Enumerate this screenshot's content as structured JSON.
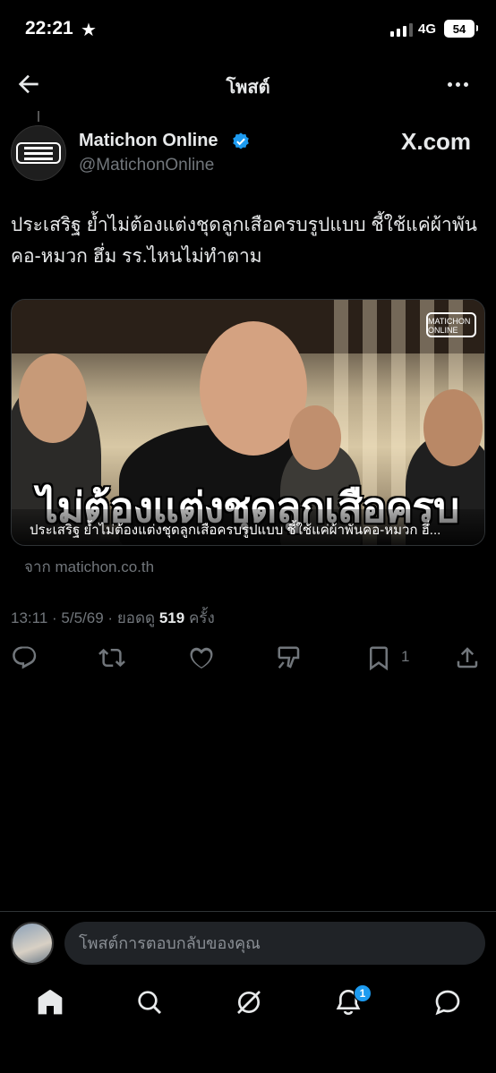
{
  "status_bar": {
    "time": "22:21",
    "network": "4G",
    "battery": "54",
    "signal_bars_active": 3,
    "signal_bars_total": 4
  },
  "nav": {
    "title": "โพสต์",
    "back_icon": "arrow-left-icon",
    "more_icon": "more-horizontal-icon"
  },
  "author": {
    "name": "Matichon Online",
    "handle": "@MatichonOnline",
    "verified": true,
    "verified_color": "#1d9bf0",
    "source_badge": "X.com"
  },
  "post": {
    "text": "ประเสริฐ ย้ำไม่ต้องแต่งชุดลูกเสือครบรูปแบบ ชี้ใช้แค่ผ้าพันคอ-หมวก ฮึ่ม รร.ไหนไม่ทำตาม"
  },
  "card": {
    "logo_sub": "MATICHON ONLINE",
    "headline": "ไม่ต้องแต่งชุดลูกเสือครบ",
    "caption": "ประเสริฐ ย้ำไม่ต้องแต่งชุดลูกเสือครบรูปแบบ ชี้ใช้แค่ผ้าพันคอ-หมวก ฮึ่...",
    "source": "จาก matichon.co.th"
  },
  "meta": {
    "time": "13:11",
    "date": "5/5/69",
    "views_label": "ยอดดู",
    "views": "519",
    "views_unit": "ครั้ง",
    "separator": "·"
  },
  "actions": {
    "bookmark_count": "1",
    "icons": [
      "reply-icon",
      "repost-icon",
      "like-icon",
      "grok-icon",
      "bookmark-icon",
      "share-icon"
    ]
  },
  "reply": {
    "placeholder": "โพสต์การตอบกลับของคุณ"
  },
  "tabbar": {
    "notification_count": "1",
    "accent": "#1d9bf0",
    "icons": [
      "home-icon",
      "search-icon",
      "grok-icon",
      "notifications-icon",
      "messages-icon"
    ]
  }
}
